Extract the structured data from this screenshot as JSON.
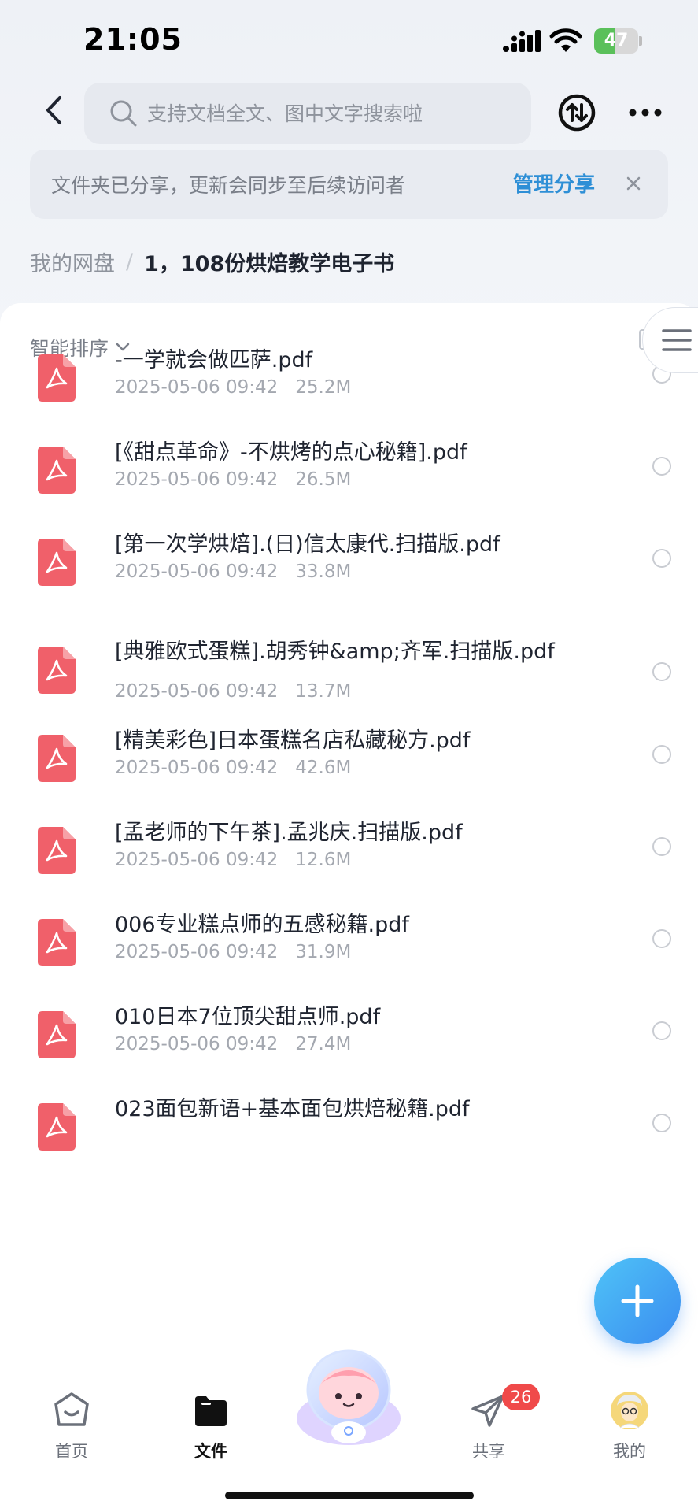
{
  "status_bar": {
    "time": "21:05",
    "battery": "47",
    "battery_level": 0.47
  },
  "header": {
    "search_placeholder": "支持文档全文、图中文字搜索啦"
  },
  "share_notice": {
    "text": "文件夹已分享，更新会同步至后续访问者",
    "action": "管理分享"
  },
  "breadcrumb": {
    "root": "我的网盘",
    "separator": "/",
    "current": "1，108份烘焙教学电子书"
  },
  "sort": {
    "label": "智能排序"
  },
  "files": [
    {
      "name": "-一学就会做匹萨.pdf",
      "date": "2025-05-06 09:42",
      "size": "25.2M"
    },
    {
      "name": "[《甜点革命》-不烘烤的点心秘籍].pdf",
      "date": "2025-05-06 09:42",
      "size": "26.5M"
    },
    {
      "name": "[第一次学烘焙].(日)信太康代.扫描版.pdf",
      "date": "2025-05-06 09:42",
      "size": "33.8M"
    },
    {
      "name": "[典雅欧式蛋糕].胡秀钟&amp;齐军.扫描版.pdf",
      "date": "2025-05-06 09:42",
      "size": "13.7M"
    },
    {
      "name": "[精美彩色]日本蛋糕名店私藏秘方.pdf",
      "date": "2025-05-06 09:42",
      "size": "42.6M"
    },
    {
      "name": "[孟老师的下午茶].孟兆庆.扫描版.pdf",
      "date": "2025-05-06 09:42",
      "size": "12.6M"
    },
    {
      "name": "006专业糕点师的五感秘籍.pdf",
      "date": "2025-05-06 09:42",
      "size": "31.9M"
    },
    {
      "name": "010日本7位顶尖甜点师.pdf",
      "date": "2025-05-06 09:42",
      "size": "27.4M"
    },
    {
      "name": "023面包新语+基本面包烘焙秘籍.pdf",
      "date": "",
      "size": ""
    }
  ],
  "bottom_nav": {
    "home": "首页",
    "files": "文件",
    "share": "共享",
    "share_badge": "26",
    "me": "我的"
  },
  "colors": {
    "accent": "#2e8fd6",
    "pdf_icon": "#f0606a",
    "fab": "#3a8cf0",
    "badge": "#f04a4a"
  }
}
